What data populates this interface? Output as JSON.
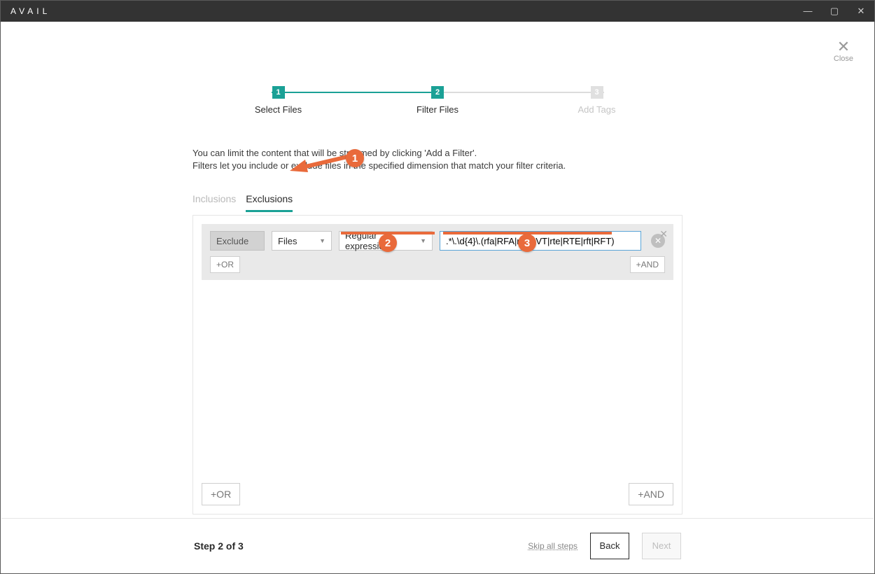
{
  "app": {
    "name": "AVAIL"
  },
  "modal": {
    "close_label": "Close"
  },
  "stepper": {
    "steps": [
      {
        "num": "1",
        "label": "Select Files"
      },
      {
        "num": "2",
        "label": "Filter Files"
      },
      {
        "num": "3",
        "label": "Add Tags"
      }
    ]
  },
  "intro": {
    "line1": "You can limit the content that will be streamed by clicking 'Add a Filter'.",
    "line2": "Filters let you include or exclude files in the specified dimension that match your filter criteria."
  },
  "tabs": {
    "inclusions": "Inclusions",
    "exclusions": "Exclusions"
  },
  "rule": {
    "mode": "Exclude",
    "scope": "Files",
    "match_type": "Regular expression",
    "value": ".*\\.\\d{4}\\.(rfa|RFA|rvt|RVT|rte|RTE|rft|RFT)"
  },
  "buttons": {
    "or_small": "+OR",
    "and_small": "+AND",
    "or": "+OR",
    "and": "+AND",
    "skip": "Skip all steps",
    "back": "Back",
    "next": "Next"
  },
  "footer": {
    "step_label": "Step 2 of 3"
  },
  "annotations": {
    "b1": "1",
    "b2": "2",
    "b3": "3"
  }
}
